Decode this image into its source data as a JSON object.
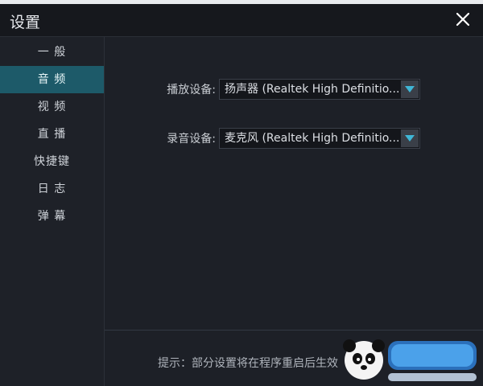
{
  "window": {
    "title": "设置",
    "close_icon": "close-icon"
  },
  "sidebar": {
    "items": [
      {
        "label": "一 般",
        "active": false
      },
      {
        "label": "音 频",
        "active": true
      },
      {
        "label": "视 频",
        "active": false
      },
      {
        "label": "直 播",
        "active": false
      },
      {
        "label": "快捷键",
        "active": false
      },
      {
        "label": "日 志",
        "active": false
      },
      {
        "label": "弹 幕",
        "active": false
      }
    ]
  },
  "audio": {
    "playback": {
      "label": "播放设备:",
      "value": "扬声器 (Realtek High Definitio..."
    },
    "recording": {
      "label": "录音设备:",
      "value": "麦克风 (Realtek High Definitio..."
    }
  },
  "footer": {
    "tip": "提示：部分设置将在程序重启后生效"
  },
  "colors": {
    "accent": "#1d5a69",
    "dropdown_arrow": "#3fb6d6",
    "background": "#1c1f26"
  }
}
